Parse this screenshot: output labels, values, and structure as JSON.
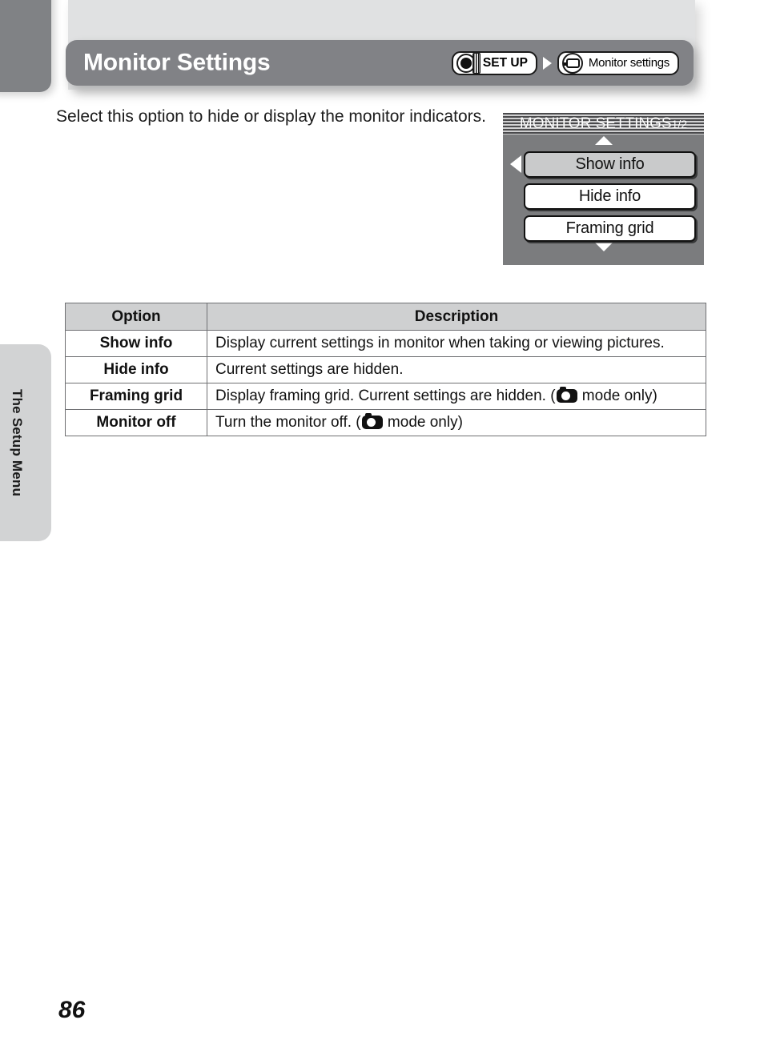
{
  "header": {
    "title": "Monitor Settings",
    "breadcrumb": [
      {
        "icon": "mode-dial-icon",
        "label": "SET UP"
      },
      {
        "icon": "monitor-icon",
        "label": "Monitor settings"
      }
    ]
  },
  "intro": {
    "text": "Select this option to hide or display the monitor indicators."
  },
  "lcd": {
    "title": "MONITOR SETTINGS",
    "page_indicator": "1/2",
    "scroll_up": "▲",
    "scroll_down": "▼",
    "items": [
      {
        "label": "Show info",
        "selected": true
      },
      {
        "label": "Hide info",
        "selected": false
      },
      {
        "label": "Framing grid",
        "selected": false
      }
    ]
  },
  "side_tab": {
    "label": "The Setup Menu"
  },
  "table": {
    "headers": [
      "Option",
      "Description"
    ],
    "rows": [
      {
        "option": "Show info",
        "description_before": "Display current settings in monitor when taking or viewing pictures.",
        "has_icon": false,
        "description_after": ""
      },
      {
        "option": "Hide info",
        "description_before": "Current settings are hidden.",
        "has_icon": false,
        "description_after": ""
      },
      {
        "option": "Framing grid",
        "description_before": "Display framing grid. Current settings are hidden. (",
        "has_icon": true,
        "description_after": " mode only)"
      },
      {
        "option": "Monitor off",
        "description_before": "Turn the monitor off. (",
        "has_icon": true,
        "description_after": " mode only)"
      }
    ]
  },
  "footer": {
    "page_number": "86"
  }
}
